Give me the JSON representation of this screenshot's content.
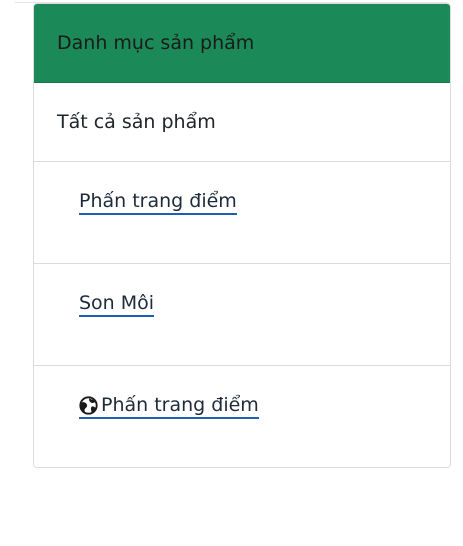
{
  "panel": {
    "header_title": "Danh mục sản phẩm",
    "all_products_label": "Tất cả sản phẩm",
    "items": [
      {
        "label": "Phấn trang điểm",
        "icon": ""
      },
      {
        "label": "Son Môi",
        "icon": ""
      },
      {
        "label": " Phấn trang điểm",
        "icon": "globe-icon"
      }
    ]
  },
  "colors": {
    "header_bg": "#1b8a58",
    "link_underline": "#1e5fb4",
    "border": "#dcdcdc"
  }
}
